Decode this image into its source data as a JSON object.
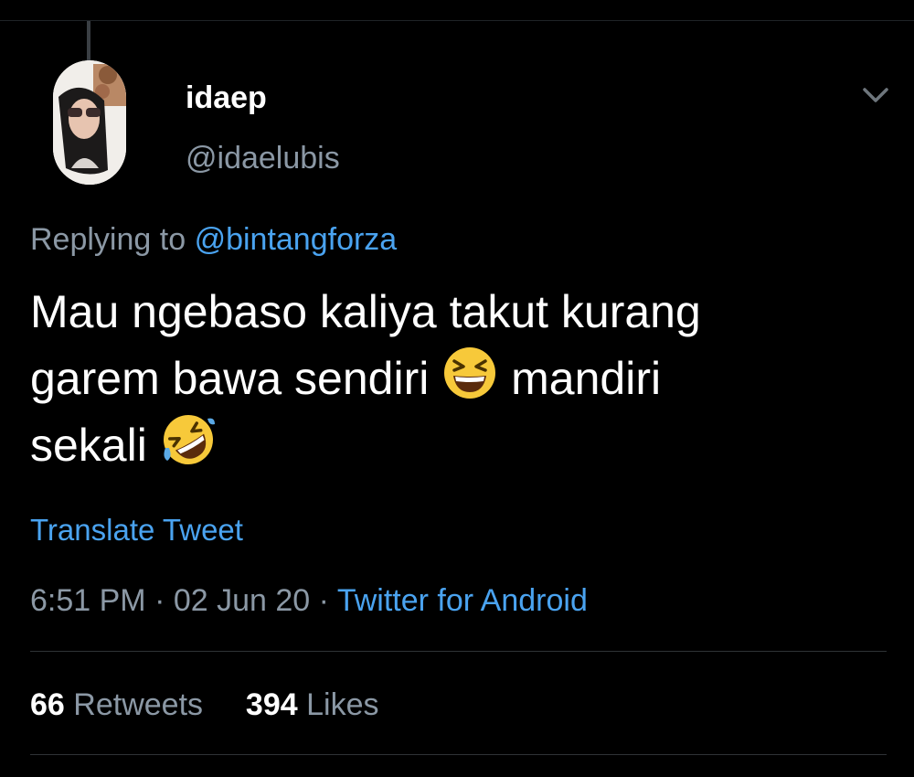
{
  "author": {
    "display_name": "idaep",
    "handle": "@idaelubis",
    "avatar_icon": "profile-photo"
  },
  "reply": {
    "prefix": "Replying to",
    "mention": "@bintangforza"
  },
  "tweet": {
    "line1": "Mau ngebaso kaliya takut kurang",
    "line2a": "garem bawa sendiri",
    "emoji1": "grinning-squinting-face",
    "line2b": "mandiri",
    "line3": "sekali",
    "emoji2": "rolling-on-the-floor-laughing"
  },
  "translate_label": "Translate Tweet",
  "meta": {
    "time": "6:51 PM",
    "separator": "·",
    "date": "02 Jun 20",
    "source": "Twitter for Android"
  },
  "stats": {
    "retweets_count": "66",
    "retweets_label": "Retweets",
    "likes_count": "394",
    "likes_label": "Likes"
  },
  "colors": {
    "background": "#000000",
    "text_primary": "#ffffff",
    "text_secondary": "#8b98a5",
    "accent": "#4aa3f0",
    "divider": "#2f3336"
  }
}
